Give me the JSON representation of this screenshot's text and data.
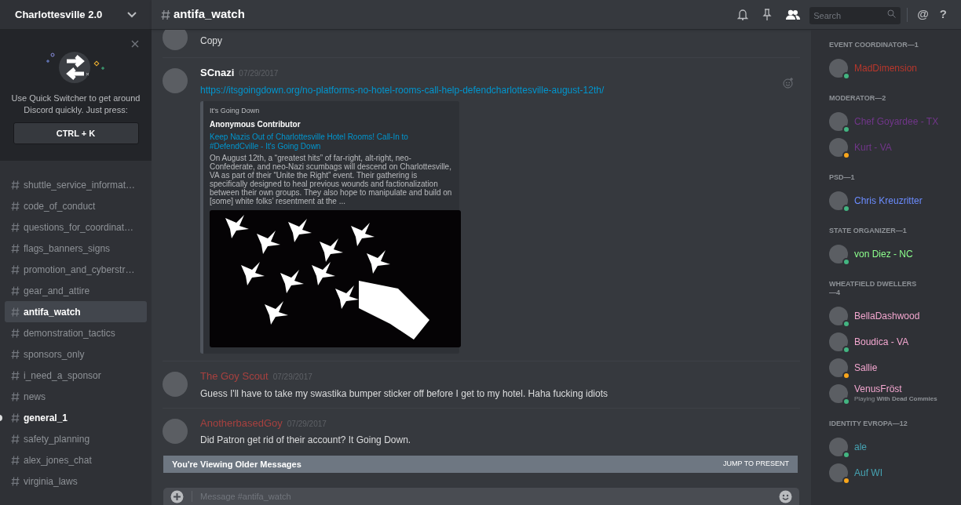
{
  "server": {
    "name": "Charlottesville 2.0"
  },
  "quick_switcher": {
    "text": "Use Quick Switcher to get around Discord quickly. Just press:",
    "shortcut": "CTRL + K"
  },
  "channels": [
    {
      "name": "shuttle_service_informat…",
      "selected": false,
      "unread": false
    },
    {
      "name": "code_of_conduct",
      "selected": false,
      "unread": false
    },
    {
      "name": "questions_for_coordinat…",
      "selected": false,
      "unread": false
    },
    {
      "name": "flags_banners_signs",
      "selected": false,
      "unread": false
    },
    {
      "name": "promotion_and_cyberstr…",
      "selected": false,
      "unread": false
    },
    {
      "name": "gear_and_attire",
      "selected": false,
      "unread": false
    },
    {
      "name": "antifa_watch",
      "selected": true,
      "unread": false
    },
    {
      "name": "demonstration_tactics",
      "selected": false,
      "unread": false
    },
    {
      "name": "sponsors_only",
      "selected": false,
      "unread": false
    },
    {
      "name": "i_need_a_sponsor",
      "selected": false,
      "unread": false
    },
    {
      "name": "news",
      "selected": false,
      "unread": false
    },
    {
      "name": "general_1",
      "selected": false,
      "unread": true
    },
    {
      "name": "safety_planning",
      "selected": false,
      "unread": false
    },
    {
      "name": "alex_jones_chat",
      "selected": false,
      "unread": false
    },
    {
      "name": "virginia_laws",
      "selected": false,
      "unread": false
    }
  ],
  "channel_header": {
    "name": "antifa_watch",
    "search_placeholder": "Search",
    "glyph_icons": [
      "@",
      "?"
    ]
  },
  "messages": [
    {
      "kind": "continuation",
      "text": "Copy"
    },
    {
      "kind": "message",
      "author": "SCnazi",
      "color": "#ffffff",
      "timestamp": "07/29/2017",
      "link": "https://itsgoingdown.org/no-platforms-no-hotel-rooms-call-help-defendcharlottesville-august-12th/",
      "embed": {
        "provider": "It's Going Down",
        "author": "Anonymous Contributor",
        "title": "Keep Nazis Out of Charlottesville Hotel Rooms! Call-In to #DefendCville - It's Going Down",
        "description": "On August 12th, a “greatest hits” of far-right, alt-right, neo-Confederate, and neo-Nazi scumbags will descend on Charlottesville, VA as part of their “Unite the Right” event. Their gathering is specifically designed to heal previous wounds and factionalization between their own groups. They also hope to manipulate and build on [some] white folks’ resentment at the ..."
      }
    },
    {
      "kind": "message",
      "author": "The Goy Scout",
      "color": "#a8413f",
      "timestamp": "07/29/2017",
      "text": "Guess I'll have to take my swastika bumper sticker off before I get to my hotel. Haha fucking idiots"
    },
    {
      "kind": "message",
      "author": "AnotherbasedGoy",
      "color": "#a8413f",
      "timestamp": "07/29/2017",
      "text": "Did Patron get rid of their account? It Going Down."
    }
  ],
  "older_messages_bar": {
    "text": "You're Viewing Older Messages",
    "action": "JUMP TO PRESENT"
  },
  "composer": {
    "placeholder": "Message #antifa_watch"
  },
  "member_groups": [
    {
      "title": "EVENT COORDINATOR—1",
      "members": [
        {
          "name": "MadDimension",
          "color": "#b8372c",
          "idle": false
        }
      ]
    },
    {
      "title": "MODERATOR—2",
      "members": [
        {
          "name": "Chef Goyardee - TX",
          "color": "#71368a",
          "idle": false
        },
        {
          "name": "Kurt - VA",
          "color": "#71368a",
          "idle": true
        }
      ]
    },
    {
      "title": "PSD—1",
      "members": [
        {
          "name": "Chris Kreuzritter",
          "color": "#6b8cff",
          "idle": false
        }
      ]
    },
    {
      "title": "STATE ORGANIZER—1",
      "members": [
        {
          "name": "von Diez - NC",
          "color": "#8dff8d",
          "idle": false
        }
      ]
    },
    {
      "title": "WHEATFIELD DWELLERS—4",
      "members": [
        {
          "name": "BellaDashwood",
          "color": "#f3a6cf",
          "idle": false
        },
        {
          "name": "Boudica - VA",
          "color": "#f3a6cf",
          "idle": false
        },
        {
          "name": "Sallie",
          "color": "#f3a6cf",
          "idle": true
        },
        {
          "name": "VenusFröst",
          "color": "#f3a6cf",
          "idle": false,
          "activity": "Playing **With Dead Commies**"
        }
      ]
    },
    {
      "title": "IDENTITY EVROPA—12",
      "members": [
        {
          "name": "ale",
          "color": "#46a3b3",
          "idle": false
        },
        {
          "name": "Auf WI",
          "color": "#46a3b3",
          "idle": true
        }
      ]
    }
  ]
}
